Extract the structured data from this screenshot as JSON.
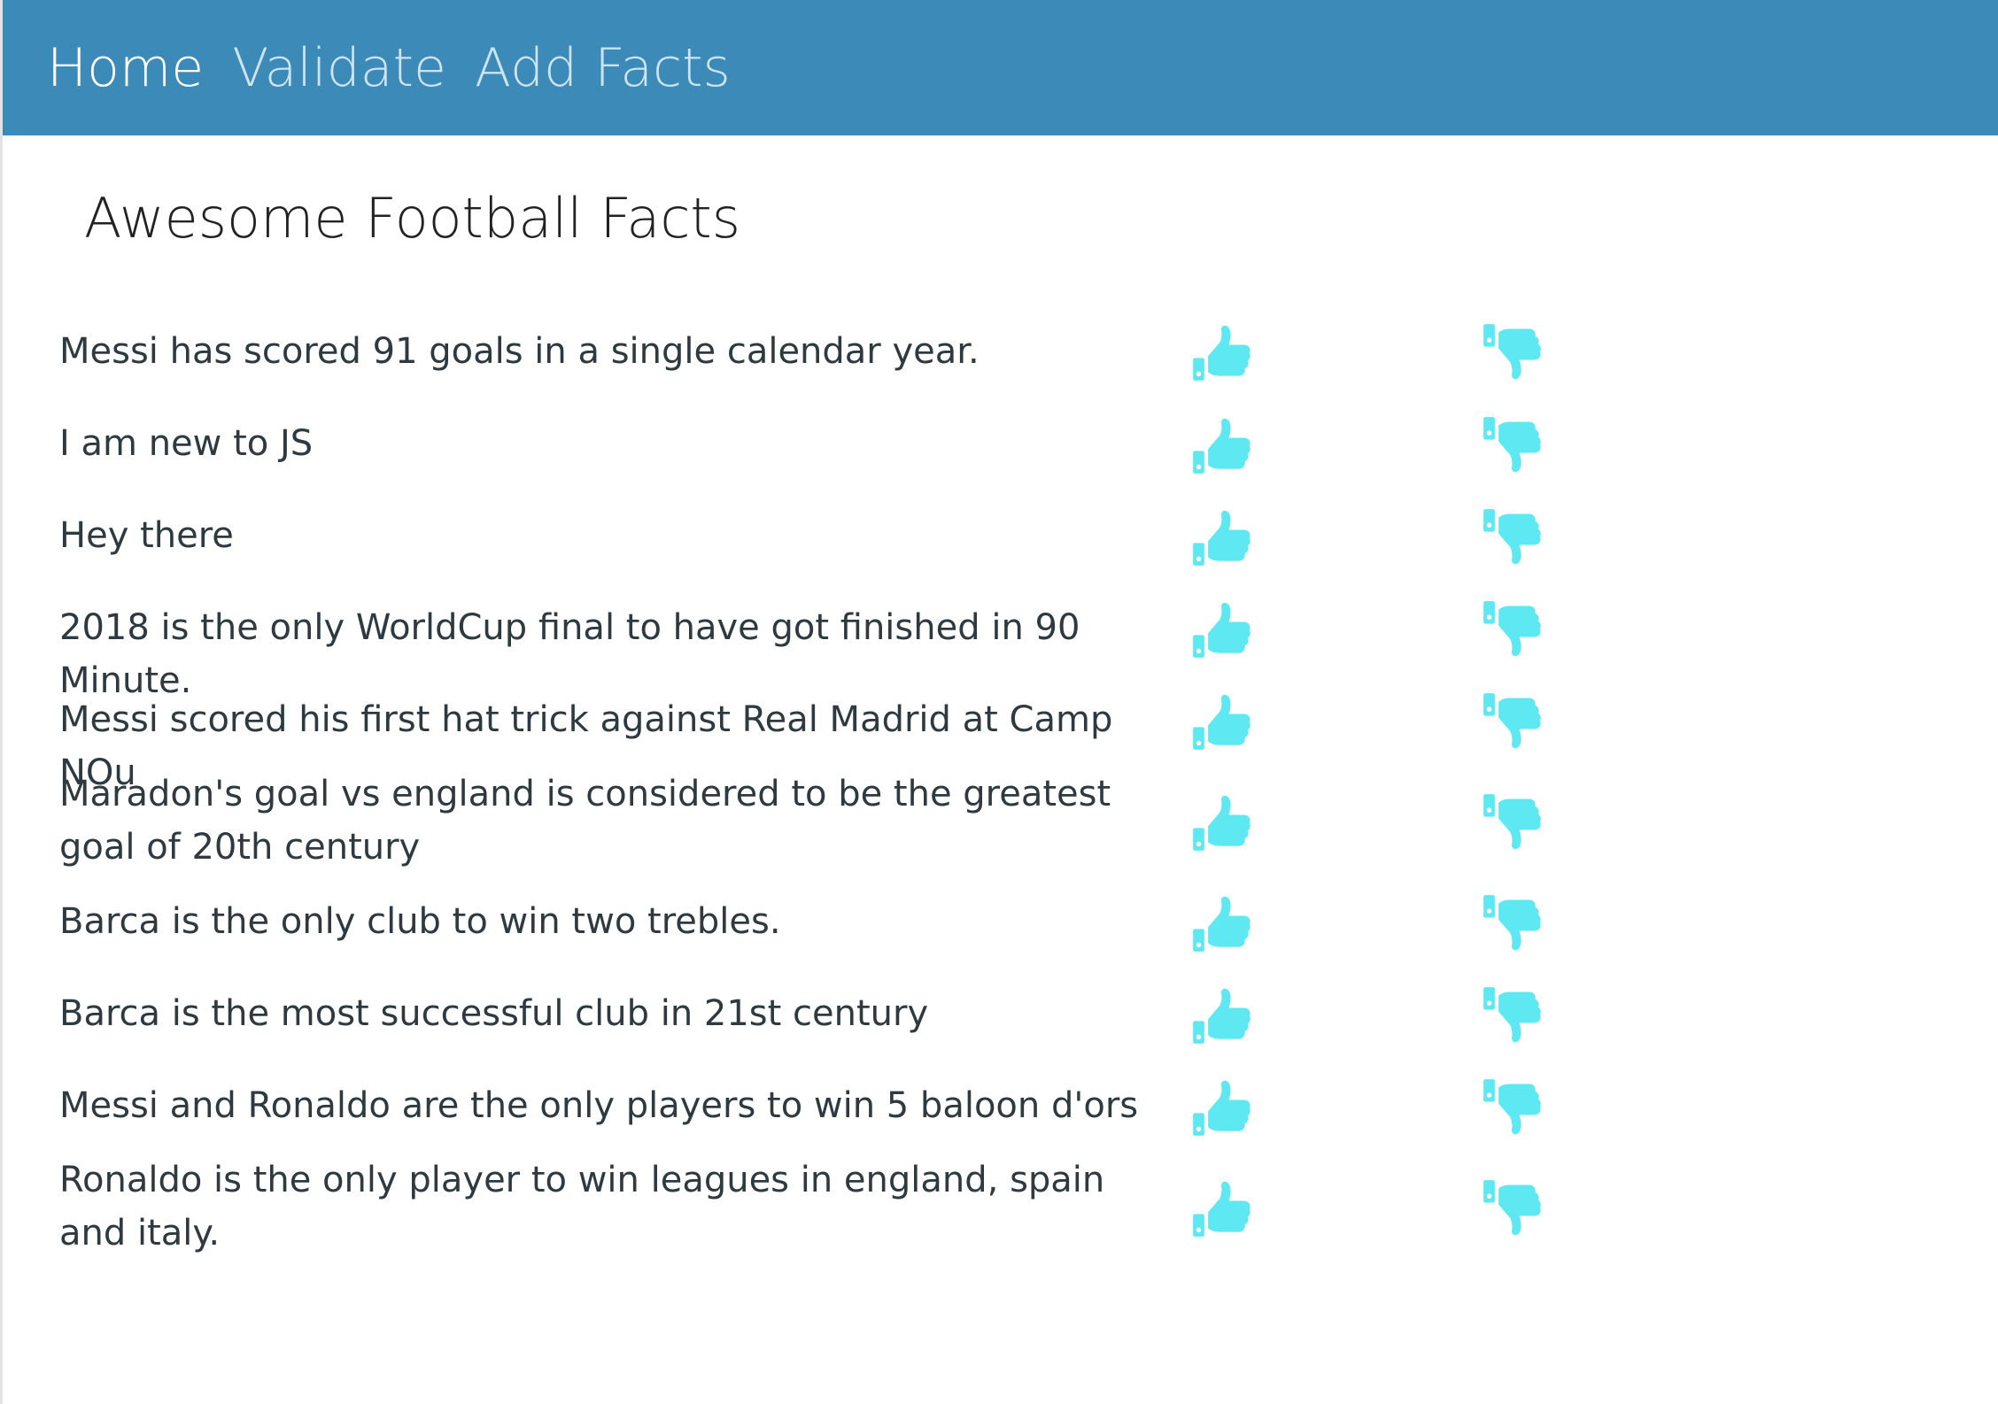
{
  "nav": {
    "items": [
      {
        "label": "Home",
        "active": true
      },
      {
        "label": "Validate",
        "active": false
      },
      {
        "label": "Add Facts",
        "active": false
      }
    ]
  },
  "page": {
    "title": "Awesome Football Facts"
  },
  "facts": [
    {
      "text": "Messi has scored 91 goals in a single calendar year."
    },
    {
      "text": "I am new to JS"
    },
    {
      "text": "Hey there"
    },
    {
      "text": "2018 is the only WorldCup final to have got finished in 90 Minute."
    },
    {
      "text": "Messi scored his first hat trick against Real Madrid at Camp NOu"
    },
    {
      "text": "Maradon's goal vs england is considered to be the greatest goal of 20th century"
    },
    {
      "text": "Barca is the only club to win two trebles."
    },
    {
      "text": "Barca is the most successful club in 21st century"
    },
    {
      "text": "Messi and Ronaldo are the only players to win 5 baloon d'ors"
    },
    {
      "text": "Ronaldo is the only player to win leagues in england, spain and italy."
    }
  ],
  "icons": {
    "upvote": "thumbs-up-icon",
    "downvote": "thumbs-down-icon"
  },
  "colors": {
    "navbar": "#3b8ab8",
    "vote_icon": "#5de8f2"
  }
}
